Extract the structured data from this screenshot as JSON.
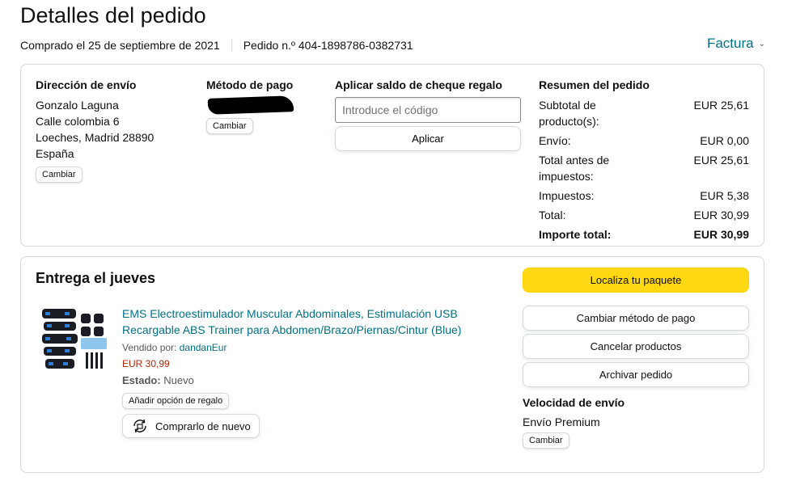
{
  "header": {
    "title": "Detalles del pedido",
    "purchased": "Comprado el 25 de septiembre de 2021",
    "order_number": "Pedido n.º 404-1898786-0382731",
    "invoice_label": "Factura"
  },
  "shipping": {
    "heading": "Dirección de envío",
    "lines": [
      "Gonzalo Laguna",
      "Calle colombia 6",
      "Loeches, Madrid 28890",
      "España"
    ],
    "change_label": "Cambiar"
  },
  "payment": {
    "heading": "Método de pago",
    "change_label": "Cambiar"
  },
  "gift_card": {
    "heading": "Aplicar saldo de cheque regalo",
    "placeholder": "Introduce el código",
    "apply_label": "Aplicar"
  },
  "summary": {
    "heading": "Resumen del pedido",
    "rows": [
      {
        "label": "Subtotal de producto(s):",
        "value": "EUR 25,61"
      },
      {
        "label": "Envío:",
        "value": "EUR 0,00"
      },
      {
        "label": "Total antes de impuestos:",
        "value": "EUR 25,61"
      },
      {
        "label": "Impuestos:",
        "value": "EUR 5,38"
      },
      {
        "label": "Total:",
        "value": "EUR 30,99"
      },
      {
        "label": "Importe total:",
        "value": "EUR 30,99"
      }
    ]
  },
  "delivery": {
    "title": "Entrega el jueves",
    "product": {
      "name": "EMS Electroestimulador Muscular Abdominales, Estimulación USB Recargable ABS Trainer para Abdomen/Brazo/Piernas/Cintur (Blue)",
      "sold_by_label": "Vendido por:",
      "seller": "dandanEur",
      "price": "EUR 30,99",
      "state_label": "Estado:",
      "state_value": "Nuevo",
      "gift_label": "Añadir opción de regalo",
      "rebuy_label": "Comprarlo de nuevo"
    },
    "actions": {
      "track": "Localiza tu paquete",
      "change_payment": "Cambiar método de pago",
      "cancel": "Cancelar productos",
      "archive": "Archivar pedido"
    },
    "speed": {
      "heading": "Velocidad de envío",
      "value": "Envío Premium",
      "change_label": "Cambiar"
    }
  },
  "colors": {
    "link": "#007185",
    "price": "#b12704",
    "primary_button": "#ffd814",
    "border": "#d5d9d9"
  }
}
